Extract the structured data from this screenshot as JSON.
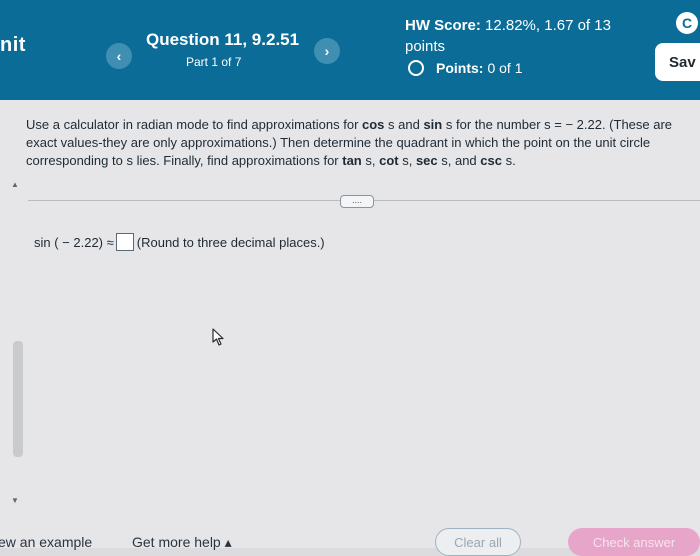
{
  "header": {
    "unit_label": "nit",
    "question_title": "Question 11, 9.2.51",
    "question_part": "Part 1 of 7",
    "prev_icon": "‹",
    "next_icon": "›",
    "hw_score_label": "HW Score:",
    "hw_score_value": "12.82%, 1.67 of 13",
    "hw_score_points": "points",
    "points_label": "Points:",
    "points_value": "0 of 1",
    "save_label": "Sav",
    "top_icon": "C",
    "background_color": "#0b6d97"
  },
  "question": {
    "instructions_part1": "Use a calculator in radian mode to find approximations for ",
    "cos_s": "cos",
    "instructions_part2": " s and ",
    "sin_s": "sin",
    "instructions_part3": " s for the number s = − 2.22. (These are exact values-they are only approximations.) Then determine the quadrant in which the point on the unit circle corresponding to s lies. Finally, find approximations for ",
    "tan_s": "tan",
    "instructions_part4": " s, ",
    "cot_s": "cot",
    "instructions_part5": " s, ",
    "sec_s": "sec",
    "instructions_part6": " s, and ",
    "csc_s": "csc",
    "instructions_part7": " s.",
    "expand_label": "....",
    "answer_prefix": "sin ( − 2.22) ≈",
    "answer_value": "",
    "answer_hint": "(Round to three decimal places.)"
  },
  "footer": {
    "view_example": "ew an example",
    "get_help": "Get more help ▴",
    "clear_all": "Clear all",
    "check_answer": "Check answer"
  }
}
